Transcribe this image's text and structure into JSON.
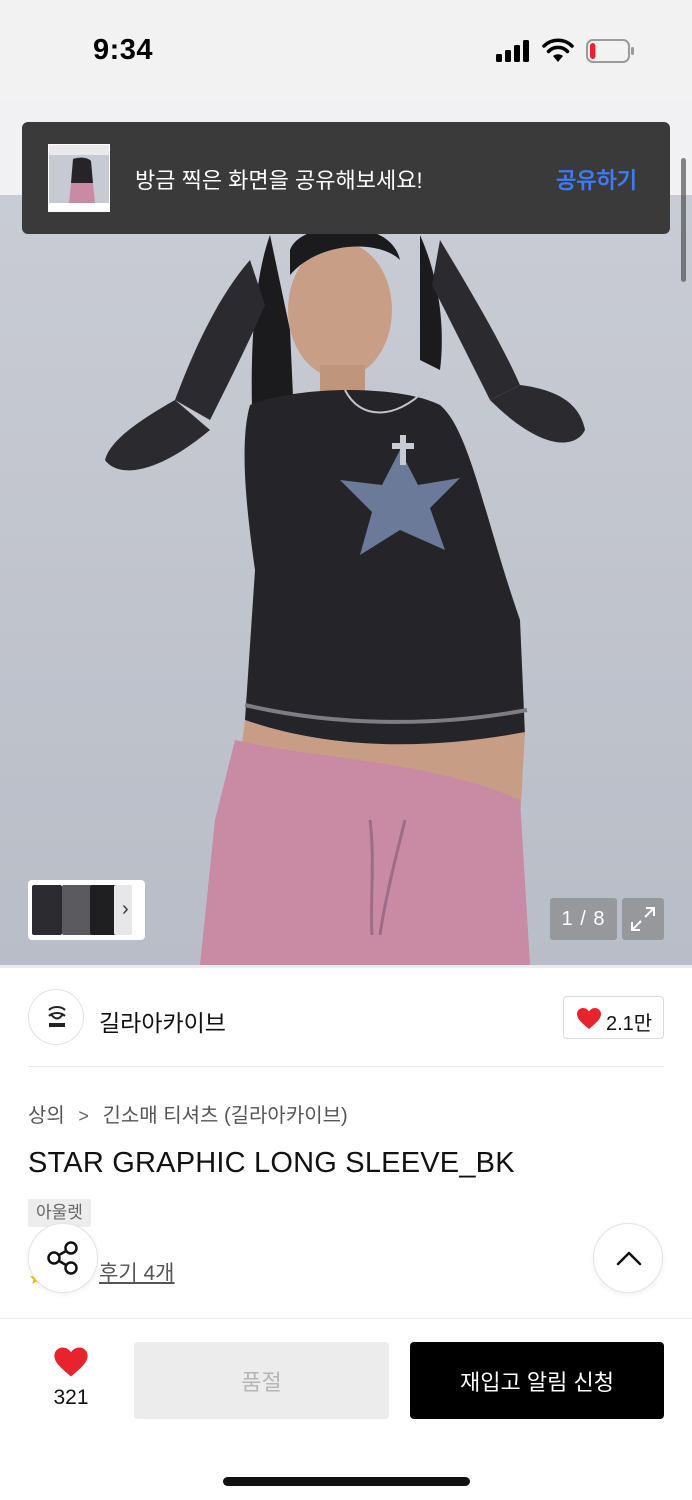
{
  "status_bar": {
    "time": "9:34",
    "battery_level": 0.15
  },
  "toast": {
    "message": "방금 찍은 화면을 공유해보세요!",
    "action_label": "공유하기"
  },
  "gallery": {
    "counter": "1 / 8",
    "thumb_chevron": "›"
  },
  "brand": {
    "name": "길라아카이브",
    "likes": "2.1만"
  },
  "breadcrumb": {
    "items": [
      "상의",
      "긴소매 티셔츠 (길라아카이브)"
    ],
    "separator": ">"
  },
  "product": {
    "title": "STAR GRAPHIC LONG SLEEVE_BK",
    "tag": "아울렛",
    "review_link": "후기 4개"
  },
  "bottom_bar": {
    "wish_count": "321",
    "soldout_label": "품절",
    "restock_label": "재입고 알림 신청"
  },
  "colors": {
    "accent_link": "#3d7bf3",
    "heart": "#e8232d",
    "primary_button": "#000000"
  }
}
